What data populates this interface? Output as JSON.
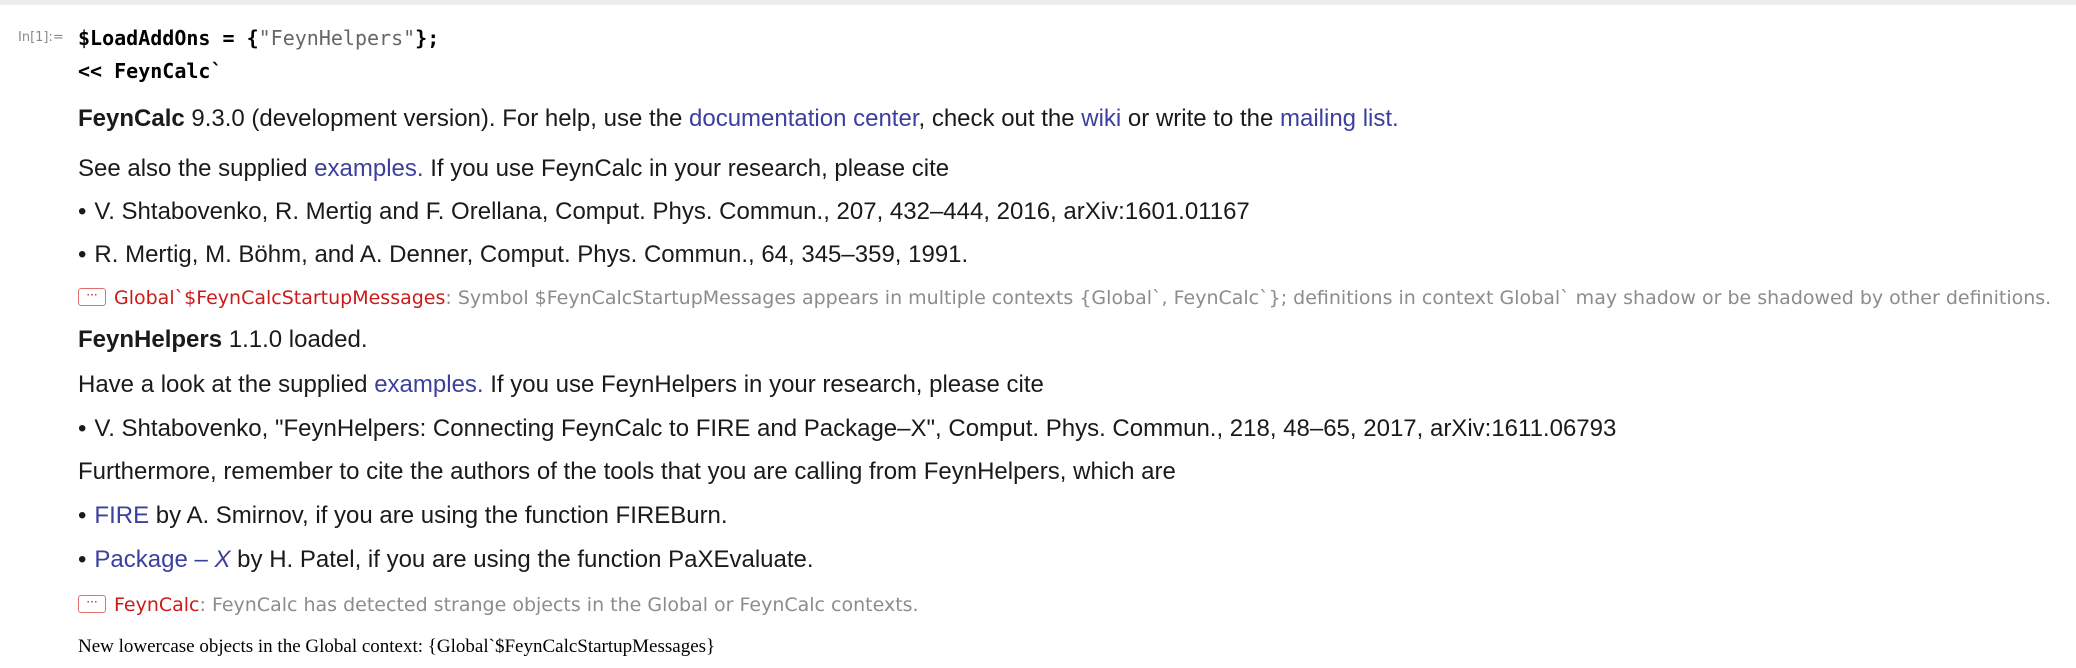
{
  "input": {
    "label": "In[1]:=",
    "line1_code": "$LoadAddOns = {",
    "line1_string": "\"FeynHelpers\"",
    "line1_end": "};",
    "line2": "<< FeynCalc`"
  },
  "feyncalc": {
    "name": "FeynCalc",
    "version_text": " 9.3.0 (development version). For help, use the ",
    "doc_link": "documentation center",
    "mid1": ", check out the ",
    "wiki_link": "wiki",
    "mid2": " or write to the ",
    "mailing_link": "mailing list.",
    "see_also": "See also the supplied ",
    "examples_link": "examples.",
    "cite_text": " If you use FeynCalc in your research, please cite",
    "refs": [
      "V. Shtabovenko, R. Mertig and F. Orellana, Comput. Phys. Commun., 207, 432–444, 2016, arXiv:1601.01167",
      "R. Mertig, M. Böhm, and A. Denner, Comput. Phys. Commun., 64, 345–359, 1991."
    ]
  },
  "message1": {
    "dots": "···",
    "tag": "Global`$FeynCalcStartupMessages",
    "text": ": Symbol $FeynCalcStartupMessages appears in multiple contexts {Global`, FeynCalc`}; definitions in context Global` may shadow or be shadowed by other definitions."
  },
  "feynhelpers": {
    "name": "FeynHelpers",
    "loaded_text": " 1.1.0 loaded.",
    "look_text": "Have a look at the supplied ",
    "examples_link": "examples.",
    "cite_text": " If you use FeynHelpers in your research, please cite",
    "ref": "V. Shtabovenko, \"FeynHelpers: Connecting FeynCalc to FIRE and Package–X\", Comput. Phys. Commun., 218, 48–65, 2017, arXiv:1611.06793",
    "furthermore": "Furthermore, remember to cite the authors of the tools that you are calling from FeynHelpers, which are",
    "fire_link": "FIRE",
    "fire_text": " by A. Smirnov, if you are using the function FIREBurn.",
    "package_link": "Package",
    "package_dash": " – ",
    "package_x": "X",
    "package_text": " by H. Patel, if you are using the function PaXEvaluate."
  },
  "message2": {
    "dots": "···",
    "tag": "FeynCalc",
    "text": ": FeynCalc has detected strange objects in the Global or FeynCalc contexts."
  },
  "final_output": "New lowercase objects in the Global context: {Global`$FeynCalcStartupMessages}",
  "bullet": "•"
}
